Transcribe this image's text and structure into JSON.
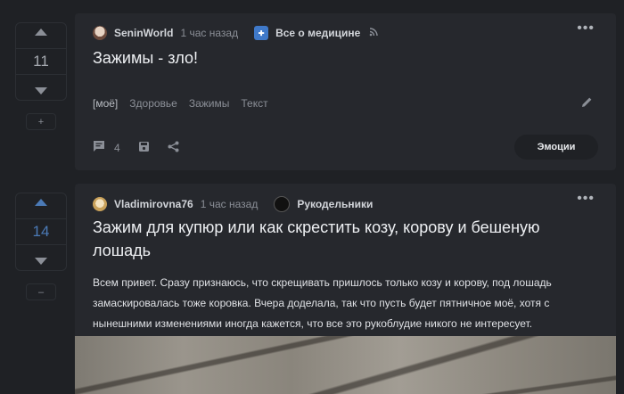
{
  "posts": [
    {
      "votes": "11",
      "author": "SeninWorld",
      "time": "1 час назад",
      "community": "Все о медицине",
      "title": "Зажимы - зло!",
      "tags": [
        "[моё]",
        "Здоровье",
        "Зажимы",
        "Текст"
      ],
      "comments": "4",
      "emotions_label": "Эмоции",
      "more_label": "•••",
      "small_btn_label": "+"
    },
    {
      "votes": "14",
      "author": "Vladimirovna76",
      "time": "1 час назад",
      "community": "Рукодельники",
      "title": "Зажим для купюр или как скрестить козу, корову и бешеную лошадь",
      "body": "Всем привет. Сразу признаюсь, что скрещивать пришлось только козу и корову, под лошадь замаскировалась тоже коровка. Вчера доделала, так что пусть будет пятничное моё, хотя с нынешними изменениями иногда кажется, что все это рукоблудие никого не интересует.",
      "more_label": "•••",
      "small_btn_label": "–",
      "vote_active": "#4b7ab6"
    }
  ],
  "icons": {
    "rss": "rss-icon",
    "comment": "comment-icon",
    "save": "save-icon",
    "share": "share-icon",
    "edit": "pencil-icon"
  }
}
